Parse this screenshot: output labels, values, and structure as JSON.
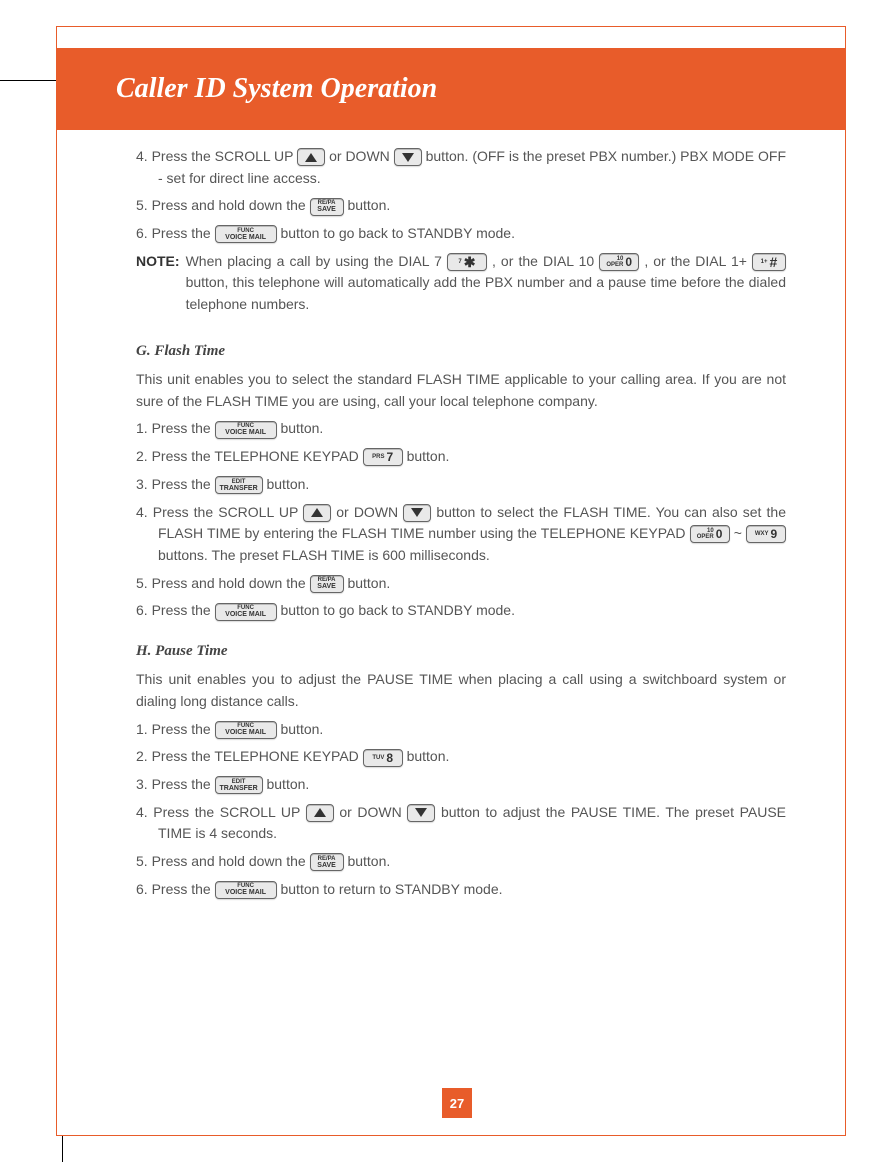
{
  "header": {
    "title": "Caller ID System Operation"
  },
  "page_number": "27",
  "keys": {
    "repa_top": "RE/PA",
    "repa_bot": "SAVE",
    "func_top": "FUNC",
    "func_bot": "VOICE MAIL",
    "edit_top": "EDIT",
    "edit_bot": "TRANSFER",
    "oper_tiny_top": "10",
    "oper_tiny": "OPER",
    "zero": "0",
    "seven_tiny": "7",
    "star": "✱",
    "hash_tiny": "1+",
    "hash": "#",
    "prs": "PRS",
    "seven": "7",
    "tuv": "TUV",
    "eight": "8",
    "wxy": "WXY",
    "nine": "9"
  },
  "pbx": {
    "s4a": "4.  Press the SCROLL UP ",
    "s4b": " or DOWN ",
    "s4c": " button. (OFF is the preset PBX number.) PBX MODE OFF - set for direct line access.",
    "s5a": "5.  Press and hold down the ",
    "s5b": " button.",
    "s6a": "6.  Press the ",
    "s6b": " button to go back to STANDBY mode.",
    "note_lbl": "NOTE:",
    "na": "When placing a call by using the DIAL 7 ",
    "nb": " , or the DIAL 10 ",
    "nc": " , or the DIAL 1+ ",
    "nd": " button, this telephone will automatically add the PBX number and a pause time before the dialed telephone numbers."
  },
  "g": {
    "title": "G. Flash Time",
    "intro": "This unit enables you to select the standard FLASH TIME applicable to your calling area. If you are not sure of the FLASH TIME you are using, call your local telephone company.",
    "s1a": "1.  Press the ",
    "s1b": " button.",
    "s2a": "2.  Press the TELEPHONE KEYPAD ",
    "s2b": " button.",
    "s3a": "3.  Press the ",
    "s3b": " button.",
    "s4a": "4.  Press the SCROLL UP ",
    "s4b": " or DOWN ",
    "s4c": " button to select the FLASH TIME. You can also set the FLASH TIME by entering the FLASH TIME number using the TELEPHONE KEYPAD ",
    "s4d": " ~ ",
    "s4e": " buttons. The preset FLASH TIME is 600 milliseconds.",
    "s5a": "5.  Press and hold down the ",
    "s5b": " button.",
    "s6a": "6.  Press the ",
    "s6b": " button to go back to STANDBY mode."
  },
  "h": {
    "title": "H. Pause Time",
    "intro": "This unit enables you to adjust the PAUSE TIME when placing a call using a switchboard system or dialing long distance calls.",
    "s1a": "1.  Press the ",
    "s1b": " button.",
    "s2a": "2.  Press the TELEPHONE KEYPAD ",
    "s2b": " button.",
    "s3a": "3.  Press the ",
    "s3b": " button.",
    "s4a": "4.  Press the SCROLL UP ",
    "s4b": " or DOWN ",
    "s4c": " button to adjust the PAUSE TIME. The preset PAUSE TIME is 4 seconds.",
    "s5a": "5.  Press and hold down the ",
    "s5b": " button.",
    "s6a": "6.  Press the ",
    "s6b": " button to return to STANDBY mode."
  }
}
